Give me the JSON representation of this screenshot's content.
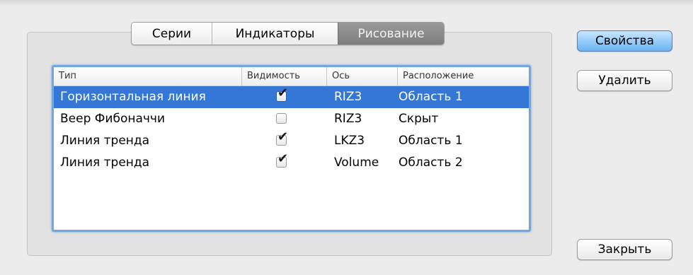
{
  "tabs": [
    {
      "label": "Серии",
      "active": false
    },
    {
      "label": "Индикаторы",
      "active": false
    },
    {
      "label": "Рисование",
      "active": true
    }
  ],
  "table": {
    "columns": [
      "Тип",
      "Видимость",
      "Ось",
      "Расположение"
    ],
    "rows": [
      {
        "type": "Горизонтальная линия",
        "visible": true,
        "axis": "RIZ3",
        "placement": "Область 1",
        "selected": true
      },
      {
        "type": "Веер Фибоначчи",
        "visible": false,
        "axis": "RIZ3",
        "placement": "Скрыт",
        "selected": false
      },
      {
        "type": "Линия тренда",
        "visible": true,
        "axis": "LKZ3",
        "placement": "Область 1",
        "selected": false
      },
      {
        "type": "Линия тренда",
        "visible": true,
        "axis": "Volume",
        "placement": "Область 2",
        "selected": false
      }
    ]
  },
  "buttons": {
    "properties": "Свойства",
    "delete": "Удалить",
    "close": "Закрыть"
  },
  "colors": {
    "selection": "#3477d6",
    "primary_button": "#6ab4f3",
    "focus_ring": "#6fa6e4"
  }
}
